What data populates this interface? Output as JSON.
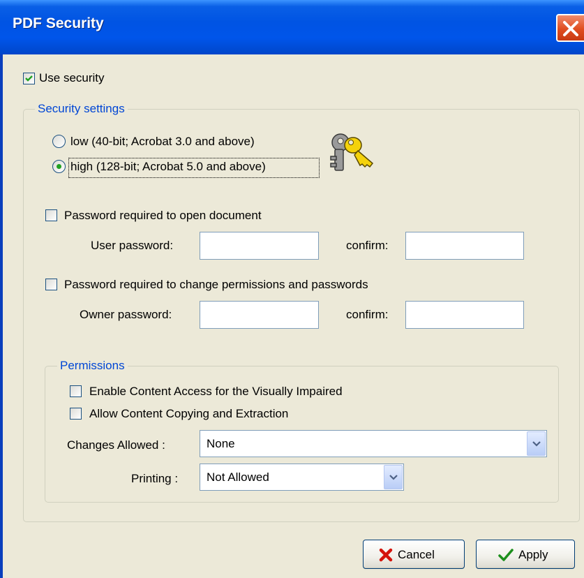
{
  "window": {
    "title": "PDF Security"
  },
  "use_security": {
    "label": "Use security",
    "checked": true
  },
  "security_settings": {
    "legend": "Security settings",
    "encryption": [
      {
        "label": "low (40-bit; Acrobat 3.0 and above)",
        "selected": false
      },
      {
        "label": "high (128-bit; Acrobat 5.0 and above)",
        "selected": true
      }
    ],
    "open_password": {
      "checkbox_label": "Password required to open document",
      "checked": false,
      "password_label": "User password:",
      "confirm_label": "confirm:"
    },
    "permissions_password": {
      "checkbox_label": "Password required to change permissions and passwords",
      "checked": false,
      "password_label": "Owner password:",
      "confirm_label": "confirm:"
    }
  },
  "permissions": {
    "legend": "Permissions",
    "accessibility": {
      "label": "Enable Content Access for the Visually Impaired",
      "checked": false
    },
    "copying": {
      "label": "Allow Content Copying and Extraction",
      "checked": false
    },
    "changes_allowed": {
      "label": "Changes Allowed :",
      "value": "None"
    },
    "printing": {
      "label": "Printing :",
      "value": "Not Allowed"
    }
  },
  "buttons": {
    "cancel": "Cancel",
    "apply": "Apply"
  },
  "icons": {
    "keys": "keys-icon",
    "cancel": "red-x-icon",
    "apply": "green-check-icon",
    "close": "close-icon"
  },
  "colors": {
    "title_bar": "#0054e3",
    "legend_text": "#0046d5",
    "close_button": "#e04d1f",
    "dialog_bg": "#ece9d8"
  }
}
